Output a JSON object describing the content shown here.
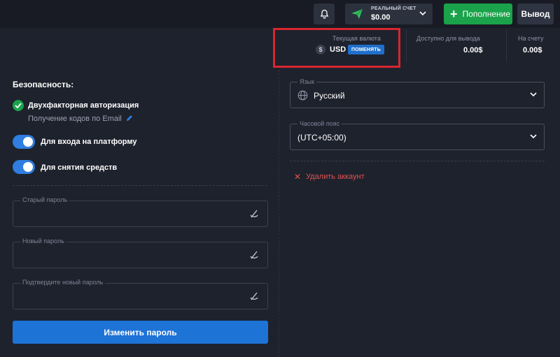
{
  "topbar": {
    "account_label": "РЕАЛЬНЫЙ СЧЕТ",
    "account_balance": "$0.00",
    "deposit_label": "Пополнение",
    "withdraw_label": "Вывод",
    "icons": [
      "bell-icon",
      "paper-plane-icon",
      "chevron-down-icon",
      "plus-icon"
    ]
  },
  "balances": {
    "currency_label": "Текущая валюта",
    "currency_code": "USD",
    "currency_symbol": "$",
    "change_label": "ПОМЕНЯТЬ",
    "available_label": "Доступно для вывода",
    "available_value": "0.00$",
    "on_account_label": "На счету",
    "on_account_value": "0.00$"
  },
  "security": {
    "title": "Безопасность:",
    "twofa_label": "Двухфакторная авторизация",
    "twofa_sub": "Получение кодов по Email",
    "toggle_login_label": "Для входа на платформу",
    "toggle_login_on": true,
    "toggle_withdraw_label": "Для снятия средств",
    "toggle_withdraw_on": true
  },
  "password": {
    "old_label": "Старый пароль",
    "new_label": "Новый пароль",
    "confirm_label": "Подтвердите новый пароль",
    "submit_label": "Изменить пароль"
  },
  "settings": {
    "language_label": "Язык",
    "language_value": "Русский",
    "timezone_label": "Часовой пояс",
    "timezone_value": "(UTC+05:00)",
    "delete_label": "Удалить аккаунт"
  },
  "colors": {
    "background": "#1e222d",
    "accent_blue": "#1e73d6",
    "success_green": "#1aa34a",
    "danger_red": "#e0534f",
    "highlight_box": "#d8262f"
  }
}
